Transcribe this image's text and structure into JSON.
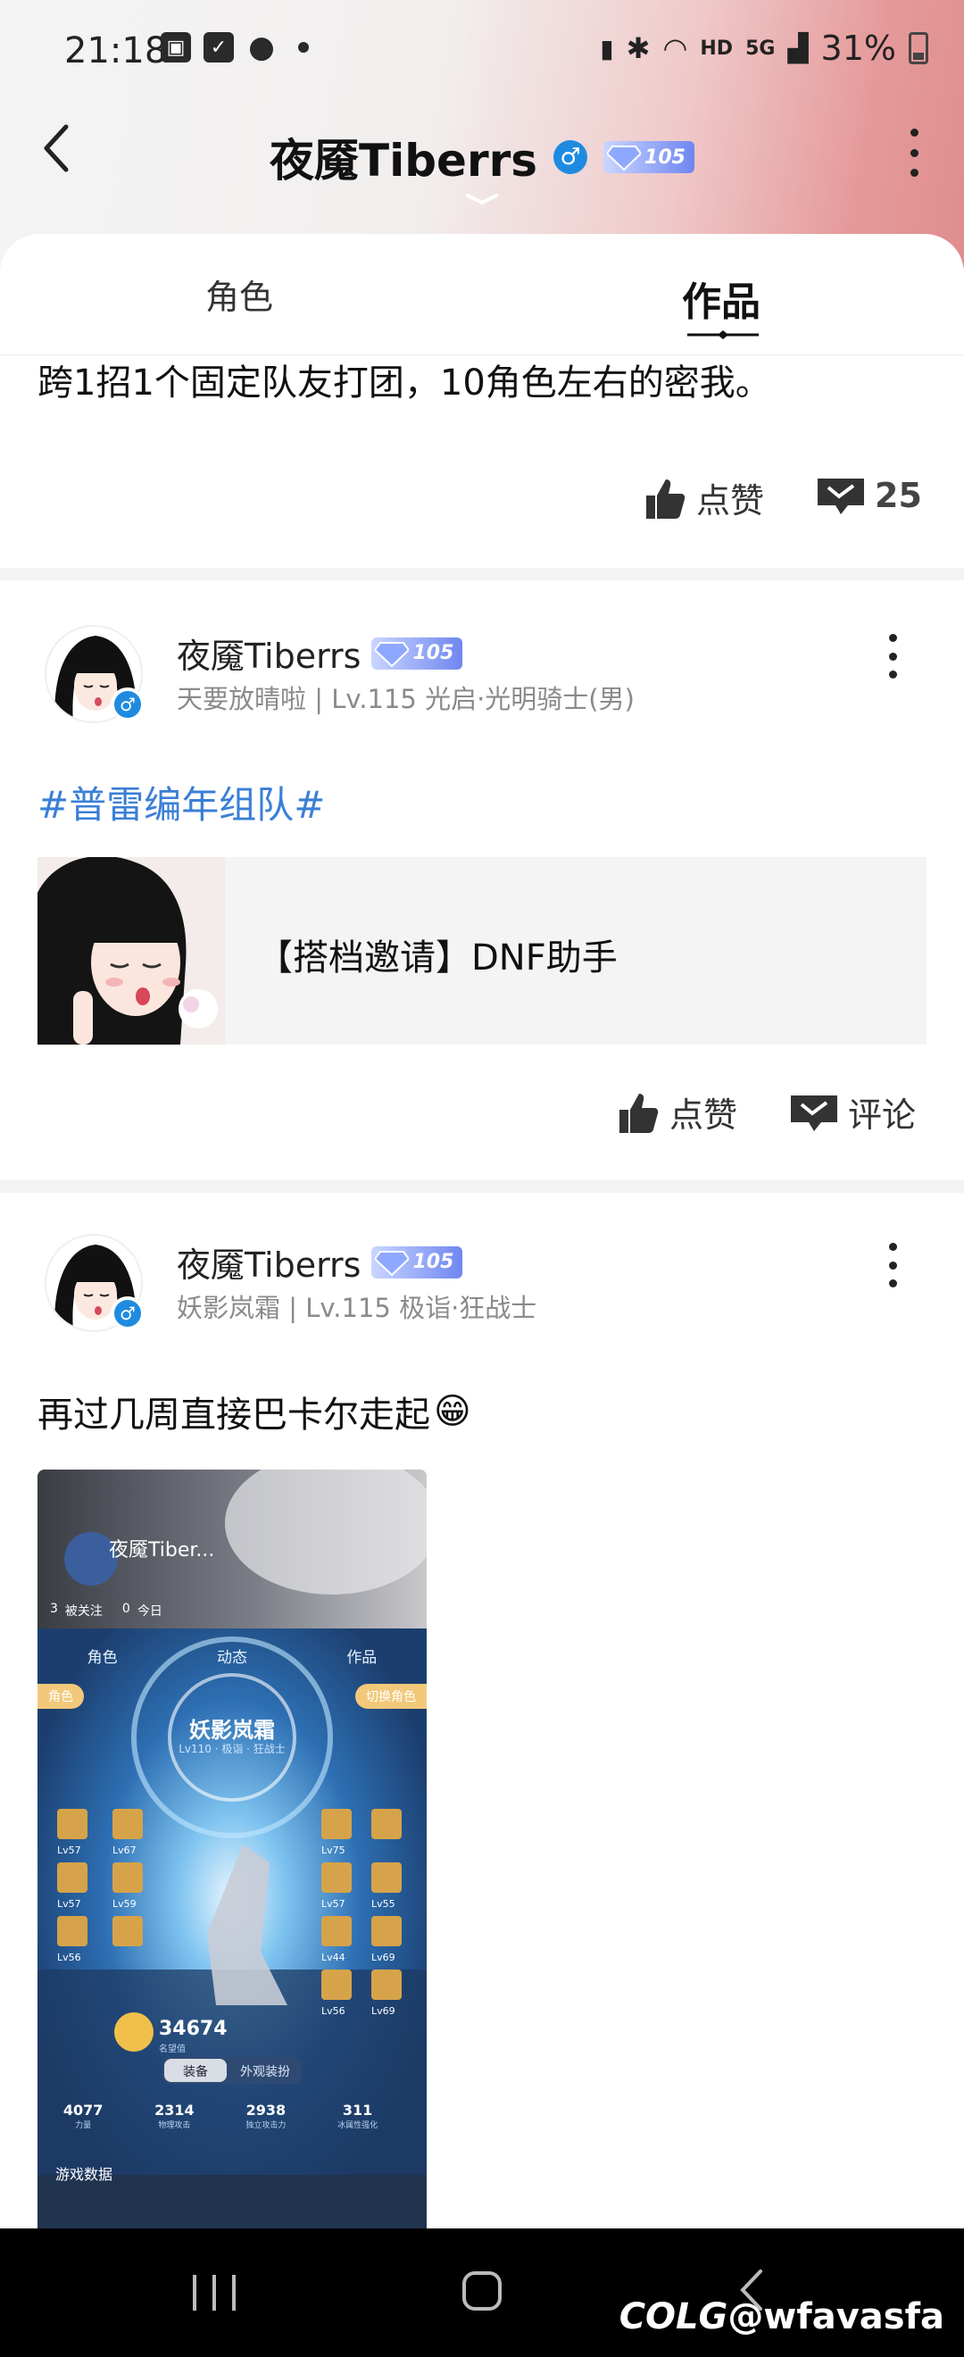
{
  "status_bar": {
    "time": "21:18",
    "battery": "31%",
    "hd": "HD",
    "net": "5G"
  },
  "header": {
    "title": "夜魇Tiberrs",
    "gender": "♂",
    "level": "105"
  },
  "tabs": {
    "role": "角色",
    "works": "作品"
  },
  "post1": {
    "text": "跨1招1个固定队友打团，10角色左右的密我。",
    "like_label": "点赞",
    "comment_count": "25"
  },
  "post2": {
    "author": "夜魇Tiberrs",
    "level": "105",
    "meta": "天要放晴啦 | Lv.115 光启·光明骑士(男)",
    "hashtag": "#普雷编年组队#",
    "share_title": "【搭档邀请】DNF助手",
    "like_label": "点赞",
    "comment_label": "评论"
  },
  "post3": {
    "author": "夜魇Tiberrs",
    "level": "105",
    "meta": "妖影岚霜 | Lv.115 极诣·狂战士",
    "text": "再过几周直接巴卡尔走起",
    "emoji": "😁"
  },
  "screenshot": {
    "name": "夜魇Tiber...",
    "stats_top": [
      "3",
      "被关注",
      "0",
      "今日"
    ],
    "tab_role": "角色",
    "tab_dyn": "动态",
    "tab_works": "作品",
    "role_pill": "角色",
    "switch_pill": "切换角色",
    "char_name": "妖影岚霜",
    "char_sub": "Lv110 · 极诣 · 狂战士",
    "fame": "34674",
    "fame_label": "名望值",
    "tab_equip": "装备",
    "tab_look": "外观装扮",
    "stats": [
      {
        "v": "4077",
        "l": "力量"
      },
      {
        "v": "2314",
        "l": "物理攻击"
      },
      {
        "v": "2938",
        "l": "独立攻击力"
      },
      {
        "v": "311",
        "l": "冰属性强化"
      }
    ],
    "game_data": "游戏数据",
    "levels_left": [
      "Lv57",
      "Lv67",
      "Lv57",
      "Lv59",
      "Lv56",
      ""
    ],
    "levels_right": [
      "Lv75",
      "",
      "Lv57",
      "Lv55",
      "Lv44",
      "Lv69",
      "Lv56",
      "Lv69"
    ]
  },
  "watermark": {
    "logo": "COLG",
    "user": "@wfavasfa"
  }
}
